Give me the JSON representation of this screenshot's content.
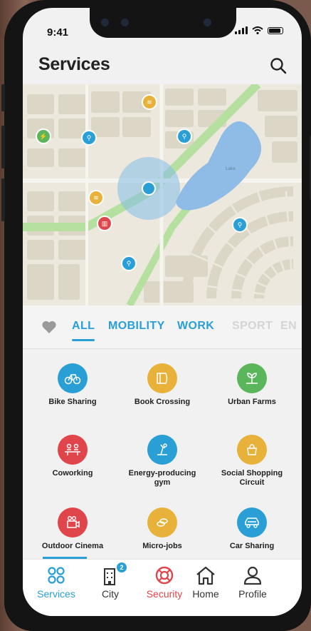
{
  "status": {
    "time": "9:41"
  },
  "header": {
    "title": "Services"
  },
  "tabs": [
    {
      "label": "ALL",
      "active": true
    },
    {
      "label": "MOBILITY"
    },
    {
      "label": "WORK"
    },
    {
      "label": "SPORT"
    },
    {
      "label": "EN"
    }
  ],
  "services": [
    {
      "label": "Bike Sharing",
      "color": "#2a9fd6",
      "icon": "bike-icon"
    },
    {
      "label": "Book Crossing",
      "color": "#e8b23a",
      "icon": "book-icon"
    },
    {
      "label": "Urban Farms",
      "color": "#5bb55a",
      "icon": "farm-icon"
    },
    {
      "label": "Coworking",
      "color": "#e0454b",
      "icon": "coworking-icon"
    },
    {
      "label": "Energy-producing gym",
      "color": "#2a9fd6",
      "icon": "gym-icon"
    },
    {
      "label": "Social Shopping Circuit",
      "color": "#e8b23a",
      "icon": "shopping-icon"
    },
    {
      "label": "Outdoor Cinema",
      "color": "#e0454b",
      "icon": "cinema-icon"
    },
    {
      "label": "Micro-jobs",
      "color": "#e8b23a",
      "icon": "coins-icon"
    },
    {
      "label": "Car Sharing",
      "color": "#2a9fd6",
      "icon": "car-icon"
    }
  ],
  "nav": [
    {
      "label": "Services",
      "color": "#2a9fd6",
      "icon": "services-grid-icon"
    },
    {
      "label": "City",
      "color": "#333333",
      "icon": "city-building-icon",
      "badge": "2"
    },
    {
      "label": "Security",
      "color": "#e0454b",
      "icon": "lifebuoy-icon"
    },
    {
      "label": "Home",
      "color": "#333333",
      "icon": "home-icon"
    },
    {
      "label": "Profile",
      "color": "#333333",
      "icon": "profile-icon"
    }
  ],
  "map": {
    "lake_label": "Lake"
  }
}
